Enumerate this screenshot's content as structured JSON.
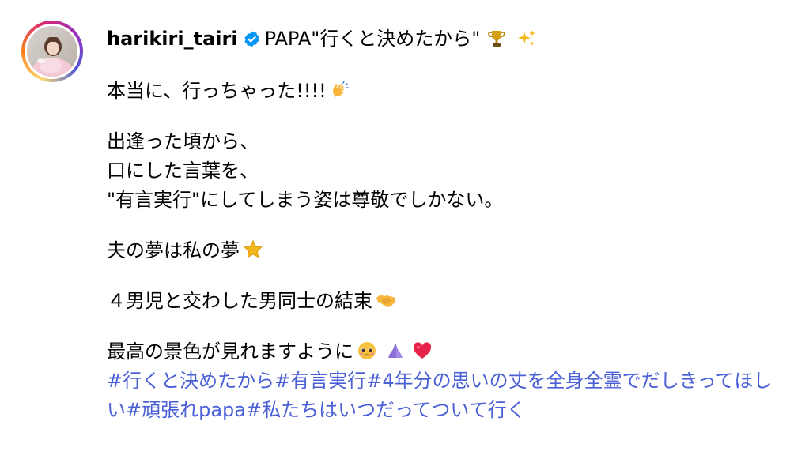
{
  "post": {
    "username": "harikiri_tairi",
    "title": "PAPA\"行くと決めたから\"",
    "title_emojis": [
      "trophy-icon",
      "sparkles-icon"
    ],
    "lines": [
      {
        "text": "本当に、行っちゃった!!!!",
        "emoji": "clapping-hands-icon"
      },
      {
        "text": "出逢った頃から、"
      },
      {
        "text": "口にした言葉を、"
      },
      {
        "text": "\"有言実行\"にしてしまう姿は尊敬でしかない。"
      },
      {
        "text": "夫の夢は私の夢",
        "emoji": "star-icon"
      },
      {
        "text": "４男児と交わした男同士の結束",
        "emoji": "handshake-icon"
      },
      {
        "text": "最高の景色が見れますように",
        "emojis": [
          "pleading-face-icon",
          "folded-hands-icon",
          "red-heart-icon"
        ]
      }
    ],
    "hashtags": [
      "#行くと決めたから",
      "#有言実行",
      "#4年分の思いの丈を全身全霊でだしきってほしい",
      "#頑張れpapa",
      "#私たちはいつだってついて行く"
    ]
  },
  "colors": {
    "link": "#4b5fd6",
    "verified": "#0095f6",
    "text": "#000000"
  }
}
